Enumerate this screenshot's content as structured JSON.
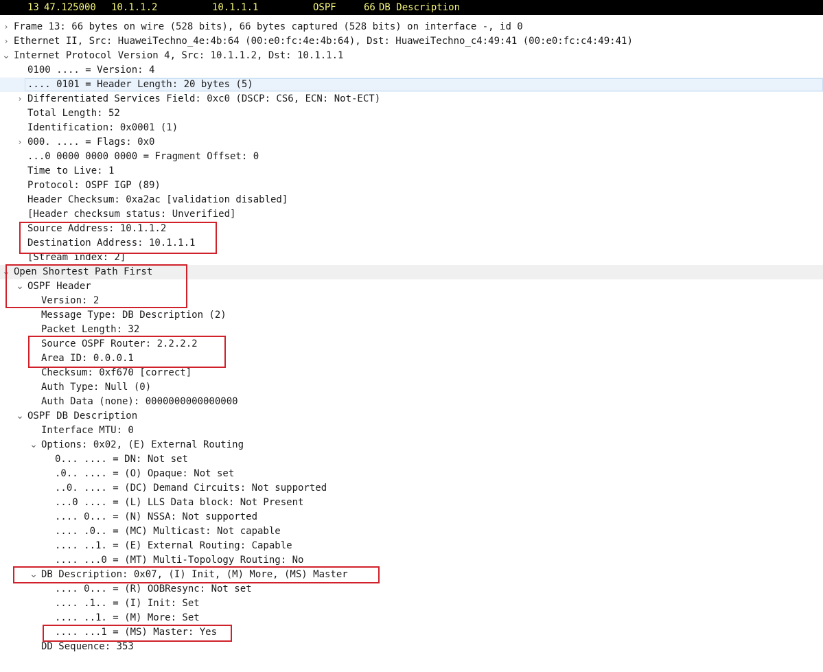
{
  "packet_list_row": {
    "no": "13",
    "time": "47.125000",
    "source": "10.1.1.2",
    "destination": "10.1.1.1",
    "protocol": "OSPF",
    "length": "66",
    "info": "DB Description"
  },
  "tree": [
    {
      "text": "Frame 13: 66 bytes on wire (528 bits), 66 bytes captured (528 bits) on interface -, id 0",
      "indent": 0,
      "toggle": "collapsed"
    },
    {
      "text": "Ethernet II, Src: HuaweiTechno_4e:4b:64 (00:e0:fc:4e:4b:64), Dst: HuaweiTechno_c4:49:41 (00:e0:fc:c4:49:41)",
      "indent": 0,
      "toggle": "collapsed"
    },
    {
      "text": "Internet Protocol Version 4, Src: 10.1.1.2, Dst: 10.1.1.1",
      "indent": 0,
      "toggle": "expanded"
    },
    {
      "text": "0100 .... = Version: 4",
      "indent": 1,
      "toggle": "none"
    },
    {
      "text": ".... 0101 = Header Length: 20 bytes (5)",
      "indent": 1,
      "toggle": "none",
      "state": "selected"
    },
    {
      "text": "Differentiated Services Field: 0xc0 (DSCP: CS6, ECN: Not-ECT)",
      "indent": 1,
      "toggle": "collapsed"
    },
    {
      "text": "Total Length: 52",
      "indent": 1,
      "toggle": "none"
    },
    {
      "text": "Identification: 0x0001 (1)",
      "indent": 1,
      "toggle": "none"
    },
    {
      "text": "000. .... = Flags: 0x0",
      "indent": 1,
      "toggle": "collapsed"
    },
    {
      "text": "...0 0000 0000 0000 = Fragment Offset: 0",
      "indent": 1,
      "toggle": "none"
    },
    {
      "text": "Time to Live: 1",
      "indent": 1,
      "toggle": "none"
    },
    {
      "text": "Protocol: OSPF IGP (89)",
      "indent": 1,
      "toggle": "none"
    },
    {
      "text": "Header Checksum: 0xa2ac [validation disabled]",
      "indent": 1,
      "toggle": "none"
    },
    {
      "text": "[Header checksum status: Unverified]",
      "indent": 1,
      "toggle": "none"
    },
    {
      "text": "Source Address: 10.1.1.2",
      "indent": 1,
      "toggle": "none"
    },
    {
      "text": "Destination Address: 10.1.1.1",
      "indent": 1,
      "toggle": "none"
    },
    {
      "text": "[Stream index: 2]",
      "indent": 1,
      "toggle": "none"
    },
    {
      "text": "Open Shortest Path First",
      "indent": 0,
      "toggle": "expanded",
      "state": "highlight"
    },
    {
      "text": "OSPF Header",
      "indent": 1,
      "toggle": "expanded"
    },
    {
      "text": "Version: 2",
      "indent": 2,
      "toggle": "none"
    },
    {
      "text": "Message Type: DB Description (2)",
      "indent": 2,
      "toggle": "none"
    },
    {
      "text": "Packet Length: 32",
      "indent": 2,
      "toggle": "none"
    },
    {
      "text": "Source OSPF Router: 2.2.2.2",
      "indent": 2,
      "toggle": "none"
    },
    {
      "text": "Area ID: 0.0.0.1",
      "indent": 2,
      "toggle": "none"
    },
    {
      "text": "Checksum: 0xf670 [correct]",
      "indent": 2,
      "toggle": "none"
    },
    {
      "text": "Auth Type: Null (0)",
      "indent": 2,
      "toggle": "none"
    },
    {
      "text": "Auth Data (none): 0000000000000000",
      "indent": 2,
      "toggle": "none"
    },
    {
      "text": "OSPF DB Description",
      "indent": 1,
      "toggle": "expanded"
    },
    {
      "text": "Interface MTU: 0",
      "indent": 2,
      "toggle": "none"
    },
    {
      "text": "Options: 0x02, (E) External Routing",
      "indent": 2,
      "toggle": "expanded"
    },
    {
      "text": "0... .... = DN: Not set",
      "indent": 3,
      "toggle": "none"
    },
    {
      "text": ".0.. .... = (O) Opaque: Not set",
      "indent": 3,
      "toggle": "none"
    },
    {
      "text": "..0. .... = (DC) Demand Circuits: Not supported",
      "indent": 3,
      "toggle": "none"
    },
    {
      "text": "...0 .... = (L) LLS Data block: Not Present",
      "indent": 3,
      "toggle": "none"
    },
    {
      "text": ".... 0... = (N) NSSA: Not supported",
      "indent": 3,
      "toggle": "none"
    },
    {
      "text": ".... .0.. = (MC) Multicast: Not capable",
      "indent": 3,
      "toggle": "none"
    },
    {
      "text": ".... ..1. = (E) External Routing: Capable",
      "indent": 3,
      "toggle": "none"
    },
    {
      "text": ".... ...0 = (MT) Multi-Topology Routing: No",
      "indent": 3,
      "toggle": "none"
    },
    {
      "text": "DB Description: 0x07, (I) Init, (M) More, (MS) Master",
      "indent": 2,
      "toggle": "expanded"
    },
    {
      "text": ".... 0... = (R) OOBResync: Not set",
      "indent": 3,
      "toggle": "none"
    },
    {
      "text": ".... .1.. = (I) Init: Set",
      "indent": 3,
      "toggle": "none"
    },
    {
      "text": ".... ..1. = (M) More: Set",
      "indent": 3,
      "toggle": "none"
    },
    {
      "text": ".... ...1 = (MS) Master: Yes",
      "indent": 3,
      "toggle": "none"
    },
    {
      "text": "DD Sequence: 353",
      "indent": 2,
      "toggle": "none"
    }
  ],
  "icons": {
    "collapsed": "chevron-right-icon",
    "expanded": "chevron-down-icon"
  },
  "colors": {
    "packet_row_bg": "#000000",
    "packet_row_fg": "#f5f57a",
    "annotation_box": "#d0202a",
    "selected_row": "#eaf2fb"
  }
}
